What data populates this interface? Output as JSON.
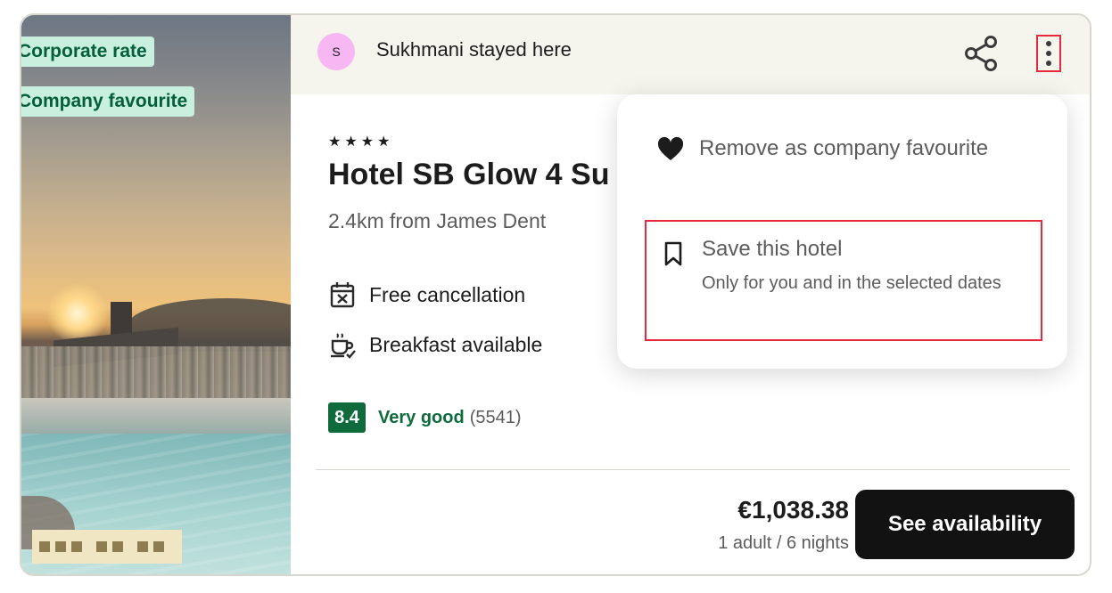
{
  "tags": {
    "corporate_rate": "Corporate rate",
    "company_favourite": "Company favourite"
  },
  "header": {
    "avatar_initial": "S",
    "stayed_text": "Sukhmani stayed here",
    "share_icon": "share-icon",
    "more_icon": "more-vertical-icon"
  },
  "hotel": {
    "stars": "★★★★",
    "star_count": 4,
    "name": "Hotel SB Glow 4 Su",
    "distance": "2.4km from James Dent",
    "amenities": [
      {
        "icon": "calendar-x-icon",
        "label": "Free cancellation"
      },
      {
        "icon": "coffee-cup-icon",
        "label": "Breakfast available"
      }
    ],
    "rating": {
      "score": "8.4",
      "label": "Very good",
      "count": "(5541)"
    }
  },
  "pricing": {
    "price": "€1,038.38",
    "detail": "1 adult / 6 nights",
    "cta": "See availability"
  },
  "menu": {
    "items": [
      {
        "icon": "heart-icon",
        "label": "Remove as company favourite"
      },
      {
        "icon": "bookmark-icon",
        "label": "Save this hotel",
        "sublabel": "Only for you and in the selected dates"
      }
    ]
  },
  "colors": {
    "accent_green": "#0f6b3c",
    "tag_bg": "#c9f0df",
    "highlight_red": "#e8283d",
    "cta_bg": "#121212"
  }
}
